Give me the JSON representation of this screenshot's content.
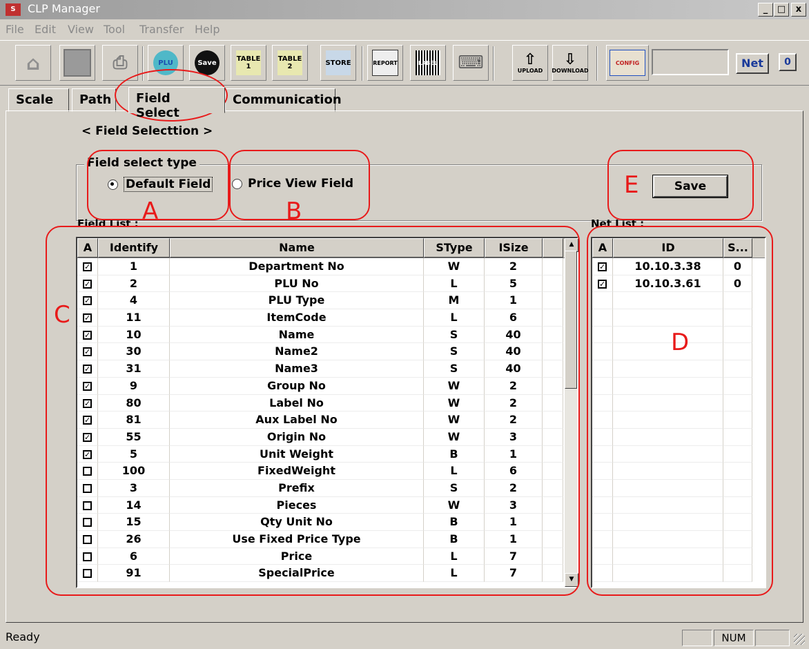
{
  "window": {
    "title": "CLP Manager",
    "min": "_",
    "max": "□",
    "close": "x"
  },
  "menu": [
    "File",
    "Edit",
    "View",
    "Tool",
    "Transfer",
    "Help"
  ],
  "toolbar": {
    "net_button": "Net",
    "counter_button": "0",
    "net_field_value": "",
    "buttons": [
      {
        "icon": "home-icon",
        "label": ""
      },
      {
        "icon": "save-icon",
        "label": ""
      },
      {
        "icon": "printer-icon",
        "label": ""
      },
      {
        "icon": "plu-icon",
        "label": "PLU"
      },
      {
        "icon": "save-store-icon",
        "label": "Save"
      },
      {
        "icon": "table1-icon",
        "label": "TABLE 1"
      },
      {
        "icon": "table2-icon",
        "label": "TABLE 2"
      },
      {
        "icon": "store-icon",
        "label": "STORE"
      },
      {
        "icon": "report-icon",
        "label": "REPORT"
      },
      {
        "icon": "label-icon",
        "label": "LABEL"
      },
      {
        "icon": "keyboard-icon",
        "label": ""
      },
      {
        "icon": "upload-icon",
        "label": "UPLOAD"
      },
      {
        "icon": "download-icon",
        "label": "DOWNLOAD"
      },
      {
        "icon": "config-icon",
        "label": "CONFIG"
      }
    ]
  },
  "tabs": [
    "Scale",
    "Path",
    "Field Select",
    "Communication"
  ],
  "active_tab": "Field Select",
  "section_title": "< Field Selecttion >",
  "field_select_type": {
    "legend": "Field select type",
    "options": [
      "Default Field",
      "Price View Field"
    ],
    "selected": "Default Field"
  },
  "save_label": "Save",
  "field_list": {
    "label": "Field List :",
    "columns": [
      "A",
      "Identify",
      "Name",
      "SType",
      "ISize"
    ],
    "rows": [
      {
        "a": true,
        "id": "1",
        "name": "Department No",
        "stype": "W",
        "isize": "2"
      },
      {
        "a": true,
        "id": "2",
        "name": "PLU No",
        "stype": "L",
        "isize": "5"
      },
      {
        "a": true,
        "id": "4",
        "name": "PLU Type",
        "stype": "M",
        "isize": "1"
      },
      {
        "a": true,
        "id": "11",
        "name": "ItemCode",
        "stype": "L",
        "isize": "6"
      },
      {
        "a": true,
        "id": "10",
        "name": "Name",
        "stype": "S",
        "isize": "40"
      },
      {
        "a": true,
        "id": "30",
        "name": "Name2",
        "stype": "S",
        "isize": "40"
      },
      {
        "a": true,
        "id": "31",
        "name": "Name3",
        "stype": "S",
        "isize": "40"
      },
      {
        "a": true,
        "id": "9",
        "name": "Group No",
        "stype": "W",
        "isize": "2"
      },
      {
        "a": true,
        "id": "80",
        "name": "Label No",
        "stype": "W",
        "isize": "2"
      },
      {
        "a": true,
        "id": "81",
        "name": "Aux Label No",
        "stype": "W",
        "isize": "2"
      },
      {
        "a": true,
        "id": "55",
        "name": "Origin No",
        "stype": "W",
        "isize": "3"
      },
      {
        "a": true,
        "id": "5",
        "name": "Unit Weight",
        "stype": "B",
        "isize": "1"
      },
      {
        "a": false,
        "id": "100",
        "name": "FixedWeight",
        "stype": "L",
        "isize": "6"
      },
      {
        "a": false,
        "id": "3",
        "name": "Prefix",
        "stype": "S",
        "isize": "2"
      },
      {
        "a": false,
        "id": "14",
        "name": "Pieces",
        "stype": "W",
        "isize": "3"
      },
      {
        "a": false,
        "id": "15",
        "name": "Qty Unit No",
        "stype": "B",
        "isize": "1"
      },
      {
        "a": false,
        "id": "26",
        "name": "Use Fixed Price Type",
        "stype": "B",
        "isize": "1"
      },
      {
        "a": false,
        "id": "6",
        "name": "Price",
        "stype": "L",
        "isize": "7"
      },
      {
        "a": false,
        "id": "91",
        "name": "SpecialPrice",
        "stype": "L",
        "isize": "7"
      }
    ]
  },
  "net_list": {
    "label": "Net List :",
    "columns": [
      "A",
      "ID",
      "S..."
    ],
    "rows": [
      {
        "a": true,
        "id": "10.10.3.38",
        "s": "0"
      },
      {
        "a": true,
        "id": "10.10.3.61",
        "s": "0"
      }
    ]
  },
  "annotations": [
    "A",
    "B",
    "C",
    "D",
    "E"
  ],
  "annotation_color": "#e81a1a",
  "status": {
    "text": "Ready",
    "num": "NUM"
  }
}
